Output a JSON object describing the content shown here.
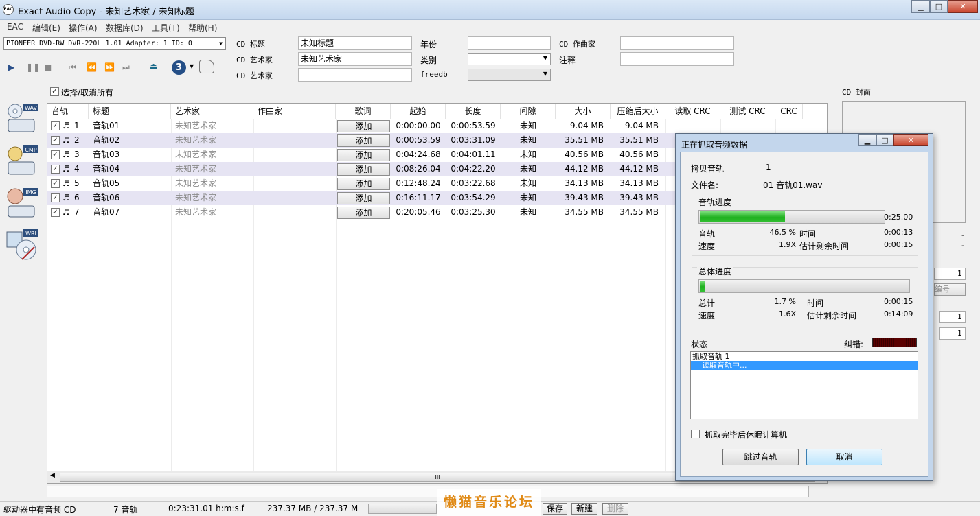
{
  "window": {
    "app_icon_text": "EAC",
    "title": "Exact Audio Copy   -   未知艺术家 / 未知标题"
  },
  "menu": [
    "EAC",
    "编辑(E)",
    "操作(A)",
    "数据库(D)",
    "工具(T)",
    "帮助(H)"
  ],
  "drive": {
    "selected": "PIONEER DVD-RW  DVR-220L 1.01   Adapter: 1  ID: 0"
  },
  "toolbar": {
    "counter_badge": "3"
  },
  "cdinfo": {
    "title_label": "CD 标题",
    "title_value": "未知标题",
    "artist_label": "CD 艺术家",
    "artist_value": "未知艺术家",
    "artist2_label": "CD 艺术家",
    "artist2_value": "",
    "year_label": "年份",
    "year_value": "",
    "genre_label": "类别",
    "genre_value": "",
    "freedb_label": "freedb",
    "freedb_value": "",
    "composer_label": "CD 作曲家",
    "composer_value": "",
    "comment_label": "注释",
    "comment_value": ""
  },
  "select_all_label": "选择/取消所有",
  "side_icons": [
    "WAV",
    "CMP",
    "IMG",
    "WRI"
  ],
  "cover_label": "CD 封面",
  "table": {
    "headers": [
      "音轨",
      "标题",
      "艺术家",
      "作曲家",
      "歌词",
      "起始",
      "长度",
      "间隙",
      "大小",
      "压缩后大小",
      "读取 CRC",
      "测试 CRC",
      "CRC"
    ],
    "add_label": "添加",
    "rows": [
      {
        "num": "1",
        "title": "音轨01",
        "artist": "未知艺术家",
        "start": "0:00:00.00",
        "length": "0:00:53.59",
        "gap": "未知",
        "size": "9.04 MB",
        "csize": "9.04 MB"
      },
      {
        "num": "2",
        "title": "音轨02",
        "artist": "未知艺术家",
        "start": "0:00:53.59",
        "length": "0:03:31.09",
        "gap": "未知",
        "size": "35.51 MB",
        "csize": "35.51 MB"
      },
      {
        "num": "3",
        "title": "音轨03",
        "artist": "未知艺术家",
        "start": "0:04:24.68",
        "length": "0:04:01.11",
        "gap": "未知",
        "size": "40.56 MB",
        "csize": "40.56 MB"
      },
      {
        "num": "4",
        "title": "音轨04",
        "artist": "未知艺术家",
        "start": "0:08:26.04",
        "length": "0:04:22.20",
        "gap": "未知",
        "size": "44.12 MB",
        "csize": "44.12 MB"
      },
      {
        "num": "5",
        "title": "音轨05",
        "artist": "未知艺术家",
        "start": "0:12:48.24",
        "length": "0:03:22.68",
        "gap": "未知",
        "size": "34.13 MB",
        "csize": "34.13 MB"
      },
      {
        "num": "6",
        "title": "音轨06",
        "artist": "未知艺术家",
        "start": "0:16:11.17",
        "length": "0:03:54.29",
        "gap": "未知",
        "size": "39.43 MB",
        "csize": "39.43 MB"
      },
      {
        "num": "7",
        "title": "音轨07",
        "artist": "未知艺术家",
        "start": "0:20:05.46",
        "length": "0:03:25.30",
        "gap": "未知",
        "size": "34.55 MB",
        "csize": "34.55 MB"
      }
    ],
    "hscroll_grip": "III"
  },
  "right_panel": {
    "value_a": "1",
    "value_b": "1",
    "value_c": "1",
    "button_fragment": "编号",
    "dash": "-"
  },
  "status": {
    "drive_state": "驱动器中有音频 CD",
    "tracks": "7 音轨",
    "duration": "0:23:31.01 h:m:s.f",
    "size": "237.37 MB / 237.37 M",
    "save": "保存",
    "new": "新建",
    "delete": "删除"
  },
  "dialog": {
    "title": "正在抓取音频数据",
    "copy_track_label": "拷贝音轨",
    "copy_track_value": "1",
    "filename_label": "文件名:",
    "filename_value": "01 音轨01.wav",
    "track_progress": {
      "group": "音轨进度",
      "percent": 46.5,
      "time_total": "0:25.00",
      "track_label": "音轨",
      "track_pct": "46.5 %",
      "time_label": "时间",
      "time_value": "0:00:13",
      "speed_label": "速度",
      "speed_value": "1.9X",
      "remaining_label": "估计剩余时间",
      "remaining_value": "0:00:15"
    },
    "total_progress": {
      "group": "总体进度",
      "percent": 1.7,
      "total_label": "总计",
      "total_pct": "1.7 %",
      "time_label": "时间",
      "time_value": "0:00:15",
      "speed_label": "速度",
      "speed_value": "1.6X",
      "remaining_label": "估计剩余时间",
      "remaining_value": "0:14:09"
    },
    "status_label": "状态",
    "error_label": "纠错:",
    "log": [
      "抓取音轨  1",
      "    读取音轨中..."
    ],
    "sleep_label": "抓取完毕后休眠计算机",
    "skip_button": "跳过音轨",
    "cancel_button": "取消",
    "colors": {
      "progress": "#22b422",
      "selection": "#3399ff",
      "error_meter": "#5a0000"
    }
  },
  "watermark": "懒猫音乐论坛"
}
